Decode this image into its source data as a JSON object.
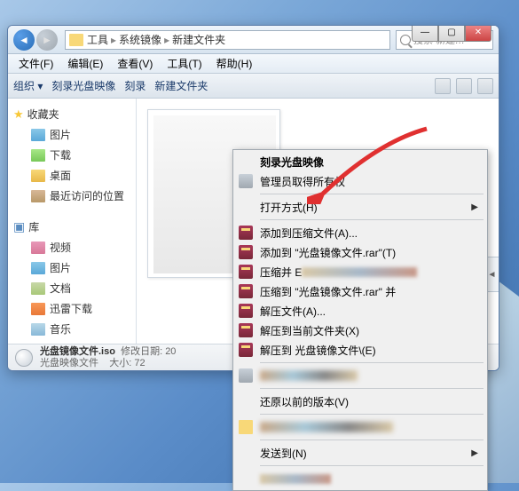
{
  "window_controls": {
    "min": "—",
    "max": "▢",
    "close": "✕"
  },
  "nav": {
    "back": "◄",
    "forward": "►"
  },
  "breadcrumb": {
    "p1": "工具",
    "p2": "系统镜像",
    "p3": "新建文件夹",
    "sep": "▸"
  },
  "search": {
    "placeholder": "搜索 新建…"
  },
  "menu": {
    "file": "文件(F)",
    "edit": "编辑(E)",
    "view": "查看(V)",
    "tools": "工具(T)",
    "help": "帮助(H)"
  },
  "toolbar": {
    "organize": "组织 ▾",
    "burn": "刻录光盘映像",
    "burn2": "刻录",
    "newfolder": "新建文件夹"
  },
  "sidebar": {
    "fav_head": "收藏夹",
    "fav": [
      {
        "label": "图片"
      },
      {
        "label": "下载"
      },
      {
        "label": "桌面"
      },
      {
        "label": "最近访问的位置"
      }
    ],
    "lib_head": "库",
    "lib": [
      {
        "label": "视频"
      },
      {
        "label": "图片"
      },
      {
        "label": "文档"
      },
      {
        "label": "迅雷下载"
      },
      {
        "label": "音乐"
      }
    ]
  },
  "status": {
    "filename": "光盘镜像文件.iso",
    "filetype": "光盘映像文件",
    "mod_label": "修改日期: 20",
    "size_label": "大小: 72"
  },
  "ctx": {
    "burn_image": "刻录光盘映像",
    "admin": "管理员取得所有权",
    "open_with": "打开方式(H)",
    "add_archive": "添加到压缩文件(A)...",
    "add_rar": "添加到 \"光盘镜像文件.rar\"(T)",
    "compress_e": "压缩并 E",
    "compress_to": "压缩到 \"光盘镜像文件.rar\" 并",
    "extract": "解压文件(A)...",
    "extract_here": "解压到当前文件夹(X)",
    "extract_to": "解压到 光盘镜像文件\\(E)",
    "restore": "还原以前的版本(V)",
    "send_to": "发送到(N)"
  },
  "side_handle": "◄"
}
